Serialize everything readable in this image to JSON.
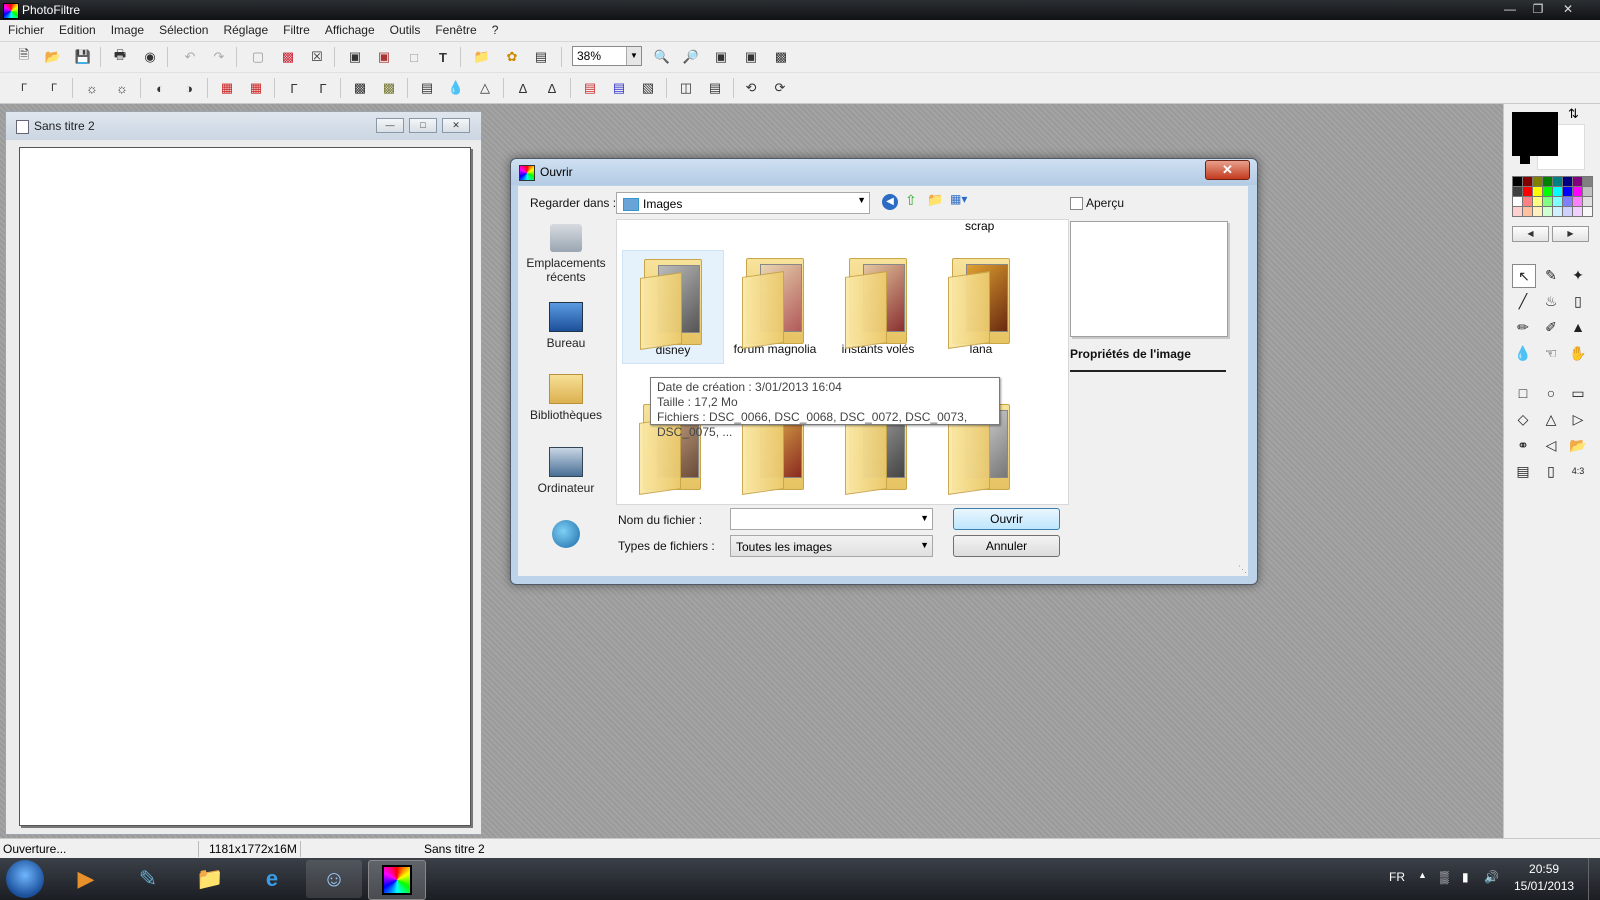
{
  "app": {
    "title": "PhotoFiltre"
  },
  "menu": [
    "Fichier",
    "Edition",
    "Image",
    "Sélection",
    "Réglage",
    "Filtre",
    "Affichage",
    "Outils",
    "Fenêtre",
    "?"
  ],
  "toolbar": {
    "zoom": "38%"
  },
  "document": {
    "title": "Sans titre 2"
  },
  "dialog": {
    "title": "Ouvrir",
    "look_in_label": "Regarder dans :",
    "look_in_value": "Images",
    "preview_label": "Aperçu",
    "properties_label": "Propriétés de l'image",
    "places": [
      {
        "label": "Emplacements récents"
      },
      {
        "label": "Bureau"
      },
      {
        "label": "Bibliothèques"
      },
      {
        "label": "Ordinateur"
      },
      {
        "label": ""
      }
    ],
    "partial_label": "scrap",
    "folders": [
      {
        "name": "disney"
      },
      {
        "name": "forum magnolia"
      },
      {
        "name": "instants volés"
      },
      {
        "name": "lana"
      }
    ],
    "tooltip": {
      "line1": "Date de création : 3/01/2013 16:04",
      "line2": "Taille : 17,2 Mo",
      "line3": "Fichiers : DSC_0066, DSC_0068, DSC_0072, DSC_0073, DSC_0075, ..."
    },
    "filename_label": "Nom du fichier :",
    "filename_value": "",
    "filetype_label": "Types de fichiers :",
    "filetype_value": "Toutes les images",
    "open_button": "Ouvrir",
    "cancel_button": "Annuler"
  },
  "status": {
    "left": "Ouverture...",
    "size": "1181x1772x16M",
    "doc": "Sans titre 2"
  },
  "taskbar": {
    "lang": "FR",
    "time": "20:59",
    "date": "15/01/2013"
  },
  "colors": {
    "accent": "#3c7fb1",
    "foreground": "#000000",
    "background": "#ffffff"
  }
}
